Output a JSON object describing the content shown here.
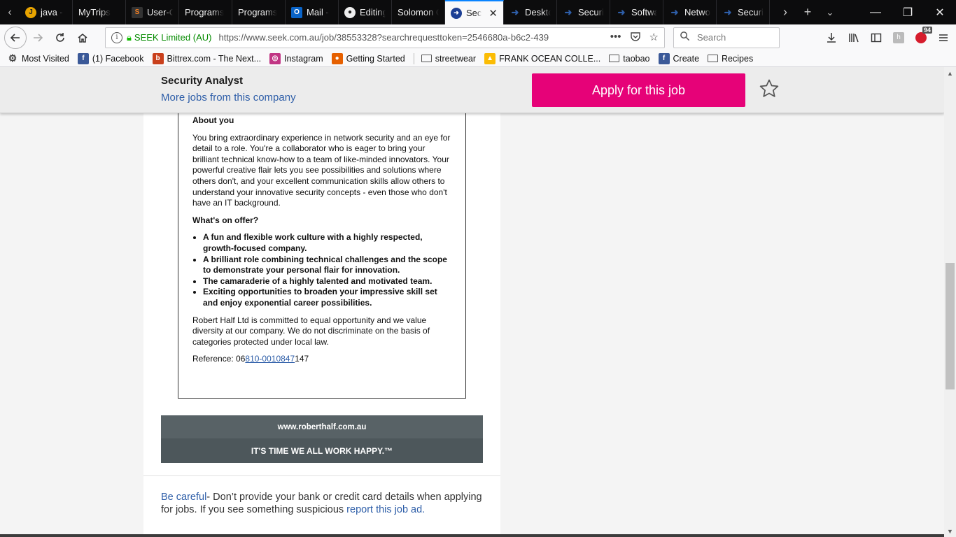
{
  "tabs": [
    {
      "label": "java - ",
      "icon": "java-icon",
      "icon_color": "#e8a400"
    },
    {
      "label": "MyTrips",
      "icon": "",
      "icon_color": ""
    },
    {
      "label": "User-C",
      "icon": "stackoverflow-icon",
      "icon_color": "#222"
    },
    {
      "label": "Programs",
      "icon": "",
      "icon_color": ""
    },
    {
      "label": "Programs",
      "icon": "",
      "icon_color": ""
    },
    {
      "label": "Mail - ",
      "icon": "outlook-icon",
      "icon_color": "#0a64c8"
    },
    {
      "label": "Editing",
      "icon": "github-icon",
      "icon_color": "#222"
    },
    {
      "label": "Solomon C",
      "icon": "",
      "icon_color": ""
    },
    {
      "label": "Sec",
      "icon": "seek-icon",
      "icon_color": "#1c3f94",
      "active": true
    },
    {
      "label": "Deskto",
      "icon": "seek-arrow-icon",
      "icon_color": "#2e5ea8"
    },
    {
      "label": "Securi",
      "icon": "seek-arrow-icon",
      "icon_color": "#2e5ea8"
    },
    {
      "label": "Softwa",
      "icon": "seek-arrow-icon",
      "icon_color": "#2e5ea8"
    },
    {
      "label": "Netwo",
      "icon": "seek-arrow-icon",
      "icon_color": "#2e5ea8"
    },
    {
      "label": "Securi",
      "icon": "seek-arrow-icon",
      "icon_color": "#2e5ea8"
    }
  ],
  "urlbar": {
    "org": "SEEK Limited (AU)",
    "url": "https://www.seek.com.au/job/38553328?searchrequesttoken=2546680a-b6c2-439"
  },
  "search": {
    "placeholder": "Search"
  },
  "toolbar": {
    "badge_count": "94"
  },
  "bookmarks": [
    {
      "label": "Most Visited",
      "icon": "gear-icon"
    },
    {
      "label": "(1) Facebook",
      "icon": "facebook-icon"
    },
    {
      "label": "Bittrex.com - The Next...",
      "icon": "bittrex-icon"
    },
    {
      "label": "Instagram",
      "icon": "instagram-icon"
    },
    {
      "label": "Getting Started",
      "icon": "firefox-icon"
    },
    {
      "label": "streetwear",
      "icon": "folder-icon"
    },
    {
      "label": "FRANK OCEAN COLLE...",
      "icon": "drive-icon"
    },
    {
      "label": "taobao",
      "icon": "folder-icon"
    },
    {
      "label": "Create",
      "icon": "facebook-icon"
    },
    {
      "label": "Recipes",
      "icon": "folder-icon"
    }
  ],
  "header": {
    "job_title": "Security Analyst",
    "more_jobs": "More jobs from this company",
    "apply_label": "Apply for this job"
  },
  "ad": {
    "about_heading": "About you",
    "about_text": "You bring extraordinary experience in network security and an eye for detail to a role. You're a collaborator who is eager to bring your brilliant technical know-how to a team of like-minded innovators. Your powerful creative flair lets you see possibilities and solutions where others don't, and your excellent communication skills allow others to understand your innovative security concepts - even those who don't have an IT background.",
    "offer_heading": "What's on offer?",
    "offer_items": [
      "A fun and flexible work culture with a highly respected, growth-focused company.",
      "A brilliant role combining technical challenges and the scope to demonstrate your personal flair for innovation.",
      "The camaraderie of a highly talented and motivated team.",
      "Exciting opportunities to broaden your impressive skill set and enjoy exponential career possibilities."
    ],
    "equal_text": "Robert Half Ltd is committed to equal opportunity and we value diversity at our company. We do not discriminate on the basis of categories protected under local law.",
    "ref_label": "Reference: ",
    "ref_prefix": "06",
    "ref_link": "810-0010847",
    "ref_suffix": "147"
  },
  "banner": {
    "site": "www.roberthalf.com.au",
    "tagline": "IT'S TIME WE ALL WORK HAPPY.™"
  },
  "warning": {
    "link1": "Be careful",
    "text": "- Don’t provide your bank or credit card details when applying for jobs. If you see something suspicious ",
    "link2": "report this job ad."
  },
  "colors": {
    "accent_pink": "#e60278",
    "link_blue": "#2e5ea8"
  }
}
